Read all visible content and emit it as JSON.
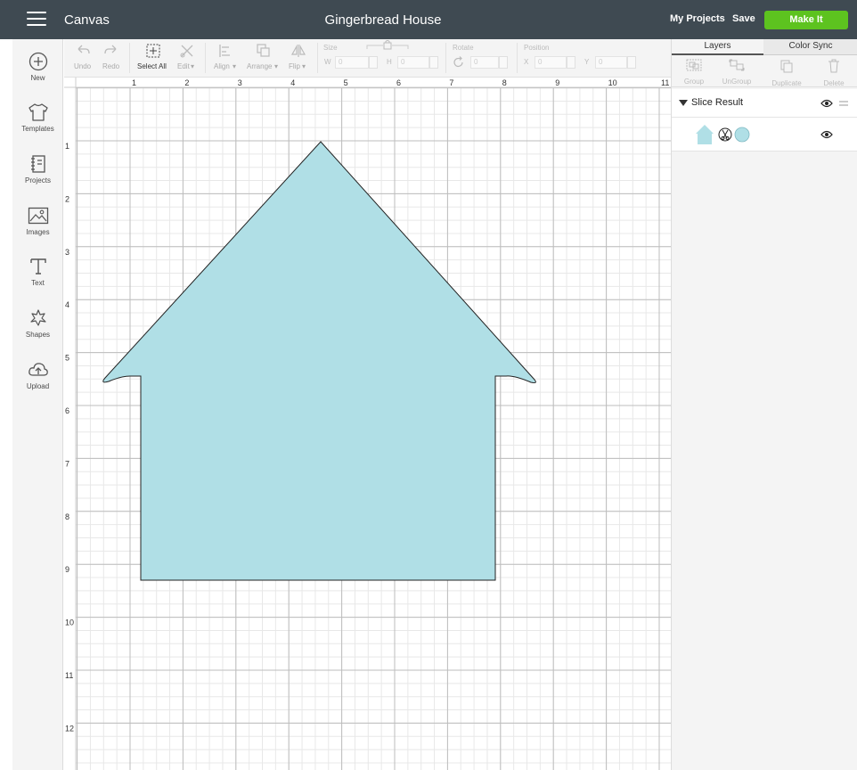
{
  "topbar": {
    "app_title": "Canvas",
    "project_title": "Gingerbread House",
    "my_projects": "My Projects",
    "save": "Save",
    "make_it": "Make It",
    "accent": "#5dc31f",
    "bar_color": "#3f4a52"
  },
  "sidebar": {
    "items": [
      {
        "label": "New",
        "icon": "plus-circle-icon"
      },
      {
        "label": "Templates",
        "icon": "tshirt-icon"
      },
      {
        "label": "Projects",
        "icon": "notebook-icon"
      },
      {
        "label": "Images",
        "icon": "image-icon"
      },
      {
        "label": "Text",
        "icon": "text-icon"
      },
      {
        "label": "Shapes",
        "icon": "shapes-icon"
      },
      {
        "label": "Upload",
        "icon": "cloud-upload-icon"
      }
    ]
  },
  "toolbar": {
    "undo": "Undo",
    "redo": "Redo",
    "select_all": "Select All",
    "edit": "Edit",
    "align": "Align",
    "arrange": "Arrange",
    "flip": "Flip",
    "size": "Size",
    "w_label": "W",
    "w_value": "0",
    "h_label": "H",
    "h_value": "0",
    "rotate": "Rotate",
    "rotate_value": "0",
    "position": "Position",
    "x_label": "X",
    "x_value": "0",
    "y_label": "Y",
    "y_value": "0"
  },
  "canvas": {
    "ruler_top": [
      "1",
      "2",
      "3",
      "4",
      "5",
      "6",
      "7",
      "8",
      "9",
      "10",
      "11"
    ],
    "ruler_left": [
      "1",
      "2",
      "3",
      "4",
      "5",
      "6",
      "7",
      "8",
      "9",
      "10",
      "11",
      "12"
    ],
    "shape_fill": "#b0dfe6",
    "shape_name": "house-shape"
  },
  "right_panel": {
    "tabs": [
      "Layers",
      "Color Sync"
    ],
    "tools": [
      "Group",
      "UnGroup",
      "Duplicate",
      "Delete"
    ],
    "layer_group_name": "Slice Result",
    "layer_color": "#b0dfe6"
  }
}
